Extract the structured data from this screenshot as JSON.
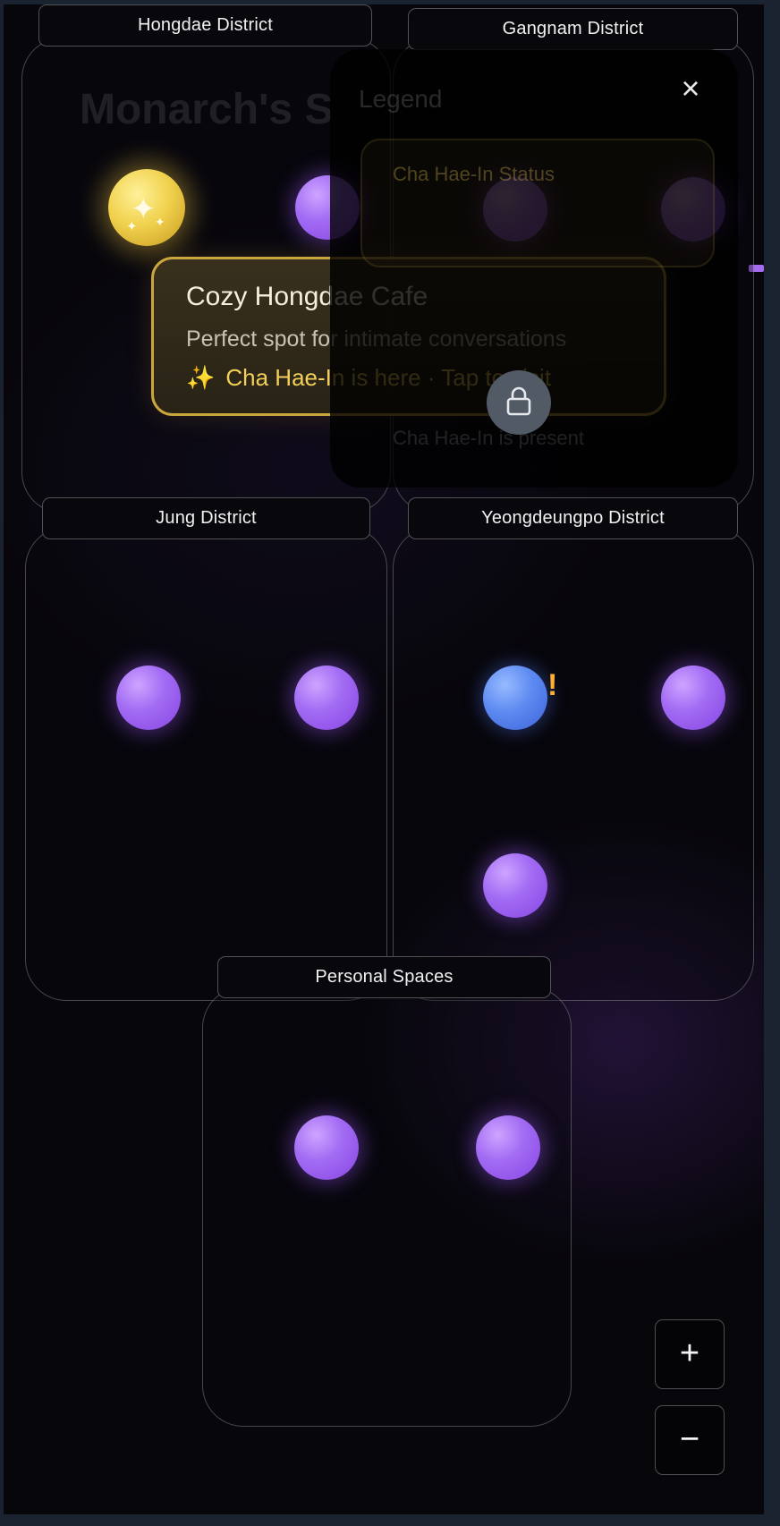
{
  "districts": [
    {
      "name": "Hongdae District"
    },
    {
      "name": "Gangnam District"
    },
    {
      "name": "Jung District"
    },
    {
      "name": "Yeongdeungpo District"
    },
    {
      "name": "Personal Spaces"
    }
  ],
  "tooltip": {
    "title": "Cozy Hongdae Cafe",
    "description": "Perfect spot for intimate conversations",
    "status_icon": "✨",
    "status": "Cha Hae-In is here · Tap to visit"
  },
  "panel": {
    "ghost_title": "Monarch's S",
    "header": "Legend",
    "ghost_line": "Cha Hae-In Status",
    "ghost_note": "Cha Hae-In is present"
  },
  "icons": {
    "close": "×",
    "zoom_in": "+",
    "zoom_out": "−",
    "lock": "lock-icon",
    "alert": "!"
  },
  "colors": {
    "node_purple": "#a36cf4",
    "node_blue": "#5d8af1",
    "node_gold": "#f1d24e",
    "tooltip_border": "#caa73c",
    "status_text": "#f2cf58",
    "alert": "#ffb02e"
  }
}
